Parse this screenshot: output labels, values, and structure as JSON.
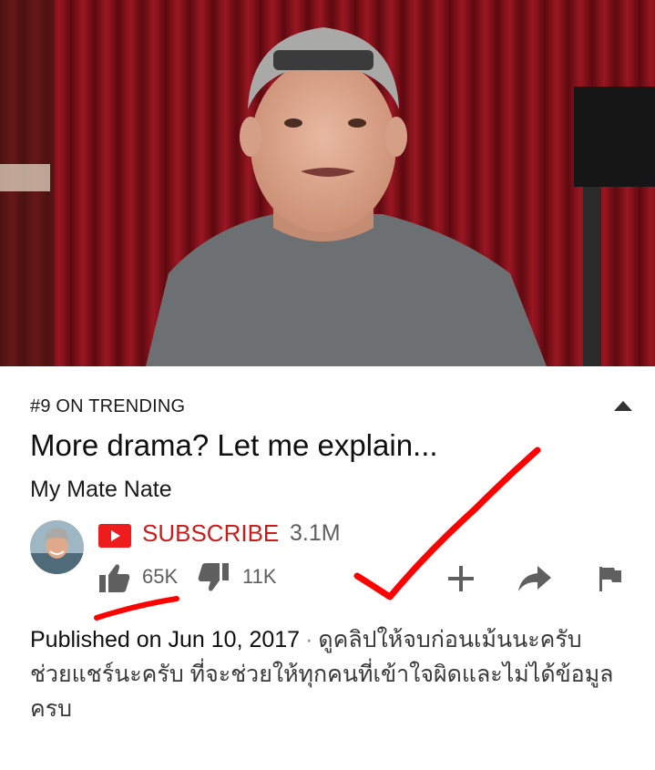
{
  "video": {
    "thumbnail": "man-in-grey-shirt-and-backwards-cap-in-front-of-red-curtain"
  },
  "info": {
    "trending": "#9 ON TRENDING",
    "title": "More drama? Let me explain...",
    "channel": "My Mate Nate",
    "subscribe_label": "SUBSCRIBE",
    "subscriber_count": "3.1M",
    "likes": "65K",
    "dislikes": "11K",
    "published": "Published on Jun 10, 2017",
    "separator": "·",
    "description_line1": "ดูคลิปให้จบก่อนเม้นนะครับ",
    "description_line2": "ช่วยแชร์นะครับ ที่จะช่วยให้ทุกคนที่เข้าใจผิดและไม่ได้ข้อมูลครบ"
  },
  "icons": {
    "collapse": "chevron-up-icon",
    "youtube": "youtube-logo-icon",
    "like": "thumbs-up-icon",
    "dislike": "thumbs-down-icon",
    "add": "plus-icon",
    "share": "share-arrow-icon",
    "flag": "flag-icon"
  },
  "colors": {
    "subscribe": "#cc1b1b",
    "annotation": "#ff0000",
    "curtain": "#7a0c14"
  }
}
